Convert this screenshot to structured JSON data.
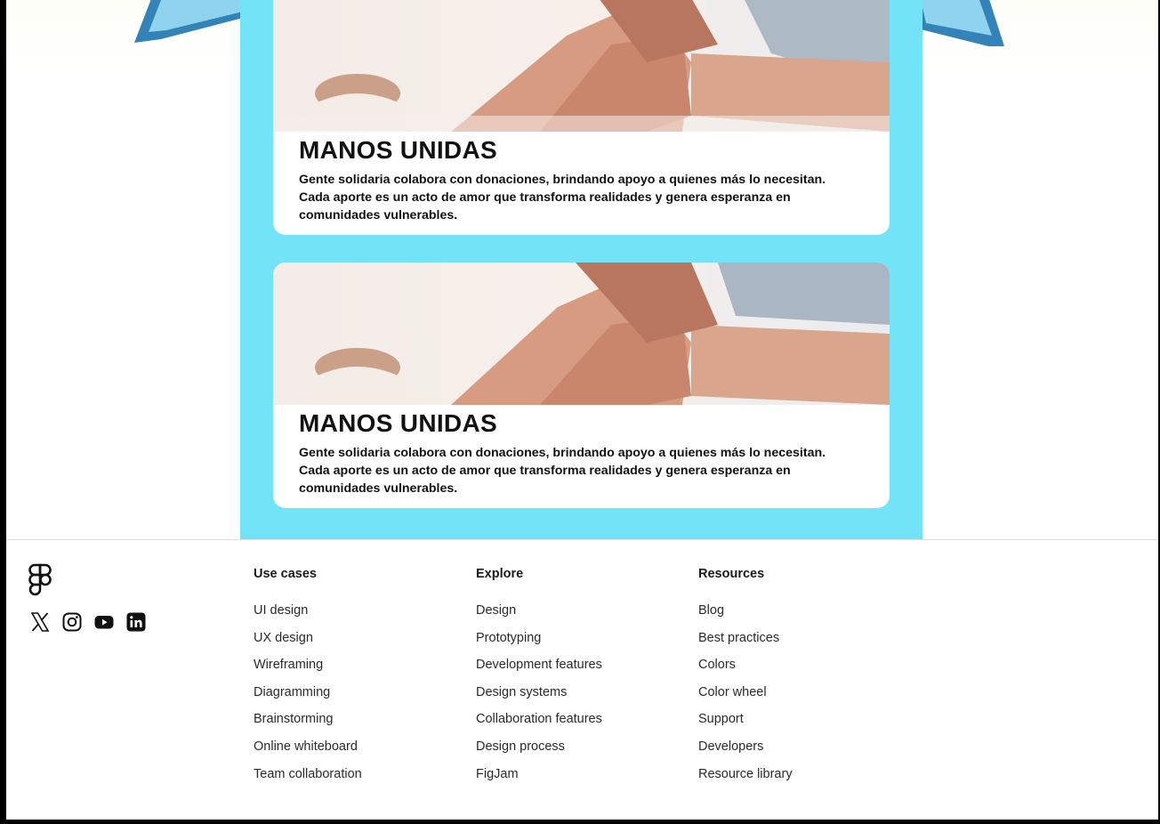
{
  "cards": [
    {
      "title": "MANOS UNIDAS",
      "text": "Gente solidaria colabora con donaciones, brindando apoyo a quienes más lo necesitan. Cada aporte es un acto de amor que transforma realidades y genera esperanza en comunidades vulnerables."
    },
    {
      "title": "MANOS UNIDAS",
      "text": "Gente solidaria colabora con donaciones, brindando apoyo a quienes más lo necesitan. Cada aporte es un acto de amor que transforma realidades y genera esperanza en comunidades vulnerables."
    }
  ],
  "footer": {
    "logo_icon": "figma-logo-icon",
    "socials": [
      "x-icon",
      "instagram-icon",
      "youtube-icon",
      "linkedin-icon"
    ],
    "columns": [
      {
        "heading": "Use cases",
        "links": [
          "UI design",
          "UX design",
          "Wireframing",
          "Diagramming",
          "Brainstorming",
          "Online whiteboard",
          "Team collaboration"
        ]
      },
      {
        "heading": "Explore",
        "links": [
          "Design",
          "Prototyping",
          "Development features",
          "Design systems",
          "Collaboration features",
          "Design process",
          "FigJam"
        ]
      },
      {
        "heading": "Resources",
        "links": [
          "Blog",
          "Best practices",
          "Colors",
          "Color wheel",
          "Support",
          "Developers",
          "Resource library"
        ]
      }
    ]
  },
  "colors": {
    "panel": "#73e4f8",
    "decor_blue": "#3383b8",
    "decor_light": "#8fd3ef"
  }
}
